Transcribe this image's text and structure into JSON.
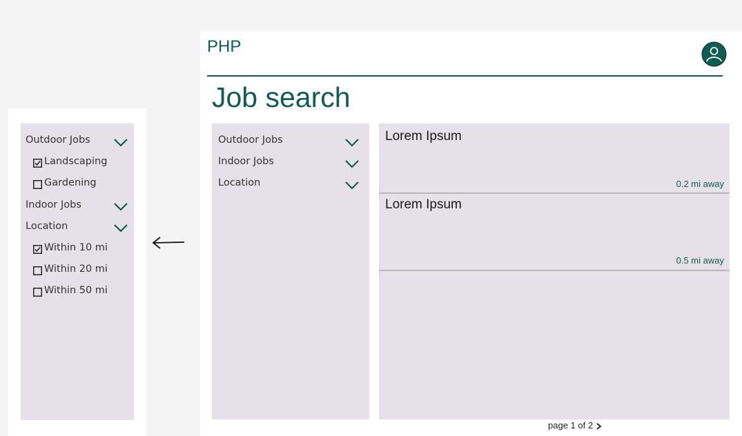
{
  "header": {
    "brand": "PHP",
    "page_title": "Job search"
  },
  "expanded_filter": {
    "sections": [
      {
        "label": "Outdoor Jobs",
        "expanded": true,
        "options": [
          {
            "label": "Landscaping",
            "checked": true
          },
          {
            "label": "Gardening",
            "checked": false
          }
        ]
      },
      {
        "label": "Indoor Jobs",
        "expanded": false,
        "options": []
      },
      {
        "label": "Location",
        "expanded": true,
        "options": [
          {
            "label": "Within 10 mi",
            "checked": true
          },
          {
            "label": "Within 20 mi",
            "checked": false
          },
          {
            "label": "Within 50 mi",
            "checked": false
          }
        ]
      }
    ]
  },
  "collapsed_filter": {
    "sections": [
      {
        "label": "Outdoor Jobs"
      },
      {
        "label": "Indoor Jobs"
      },
      {
        "label": "Location"
      }
    ]
  },
  "results": [
    {
      "title": "Lorem Ipsum",
      "distance": "0.2 mi away"
    },
    {
      "title": "Lorem Ipsum",
      "distance": "0.5 mi away"
    }
  ],
  "pagination": {
    "label": "page 1 of 2"
  },
  "icons": {
    "user": "user-avatar-icon",
    "chevron": "chevron-down-icon",
    "next": "chevron-right-icon",
    "arrow": "arrow-left-icon",
    "checkbox": "checkbox-icon"
  },
  "colors": {
    "accent": "#0f5c51",
    "panel": "#e6e1e8",
    "background": "#f4f4f4"
  }
}
